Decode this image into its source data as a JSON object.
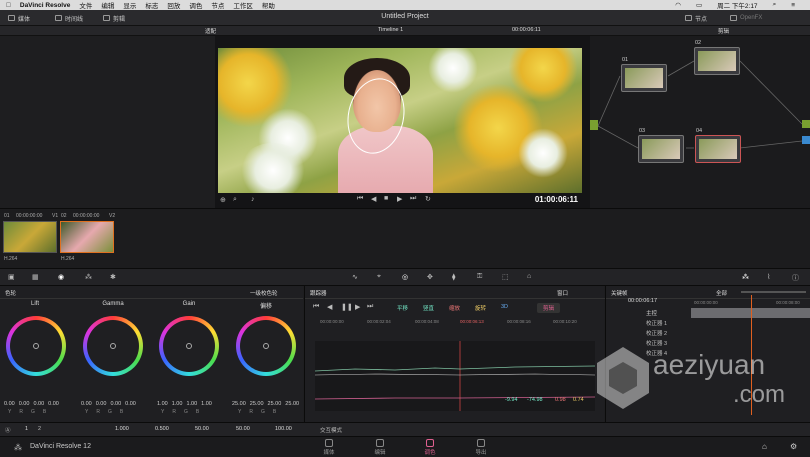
{
  "menubar": {
    "app": "DaVinci Resolve",
    "items": [
      "文件",
      "编辑",
      "显示",
      "标志",
      "回放",
      "调色",
      "节点",
      "工作区",
      "帮助"
    ],
    "clock": "周二 下午2:17"
  },
  "titlebar": {
    "media": "媒体",
    "edit": "时间线",
    "project_title": "Untitled Project",
    "nodes": "节点",
    "openfx": "OpenFX",
    "clip_btn": "剪辑"
  },
  "viewer": {
    "fit": "适配",
    "timeline": "Timeline 1",
    "timecode_top": "00:00:06:11",
    "timecode": "01:00:06:11"
  },
  "nodes": [
    {
      "num": "01"
    },
    {
      "num": "02"
    },
    {
      "num": "03"
    },
    {
      "num": "04"
    }
  ],
  "clips": [
    {
      "num": "01",
      "tc": "00:00:00:00",
      "track": "V1",
      "fmt": "H.264"
    },
    {
      "num": "02",
      "tc": "00:00:00:00",
      "track": "V2",
      "fmt": "H.264"
    }
  ],
  "wheels": {
    "header": "色轮",
    "mode": "一级校色轮",
    "items": [
      {
        "label": "Lift",
        "vals": [
          "0.00",
          "0.00",
          "0.00",
          "0.00"
        ]
      },
      {
        "label": "Gamma",
        "vals": [
          "0.00",
          "0.00",
          "0.00",
          "0.00"
        ]
      },
      {
        "label": "Gain",
        "vals": [
          "1.00",
          "1.00",
          "1.00",
          "1.00"
        ]
      },
      {
        "label": "偏移",
        "vals": [
          "25.00",
          "25.00",
          "25.00",
          "25.00"
        ]
      }
    ],
    "channels": [
      "Y",
      "R",
      "G",
      "B"
    ]
  },
  "keyframes": {
    "header": "跟踪器",
    "window": "窗口",
    "checks": [
      "平移",
      "竖直",
      "缩放",
      "旋转",
      "3D"
    ],
    "clip": "剪辑",
    "times": [
      "00:00:00:00",
      "00:00:02:04",
      "00:00:04:08",
      "00:00:06:13",
      "00:00:08:16",
      "00:00:10:20"
    ],
    "values": [
      "-9.94",
      "-74.98",
      "0.98",
      "0.74"
    ]
  },
  "right_panel": {
    "header": "关键帧",
    "all": "全部",
    "tc": "00:00:06:17",
    "tc2": "00:00:00:00",
    "tc3": "00:00:08:00",
    "rows": [
      "主控",
      "校正器 1",
      "校正器 2",
      "校正器 3",
      "校正器 4"
    ]
  },
  "bottom_params": {
    "page_a": "1",
    "page_b": "2",
    "v1": "1.000",
    "v2": "0.500",
    "v3": "50.00",
    "v4": "50.00",
    "v5": "100.00",
    "track_mode": "交互模式"
  },
  "pages": {
    "brand": "DaVinci Resolve 12",
    "media": "媒体",
    "edit": "编辑",
    "color": "调色",
    "deliver": "导出"
  },
  "watermark": {
    "line1": "aeziyuan",
    "line2": ".com"
  }
}
